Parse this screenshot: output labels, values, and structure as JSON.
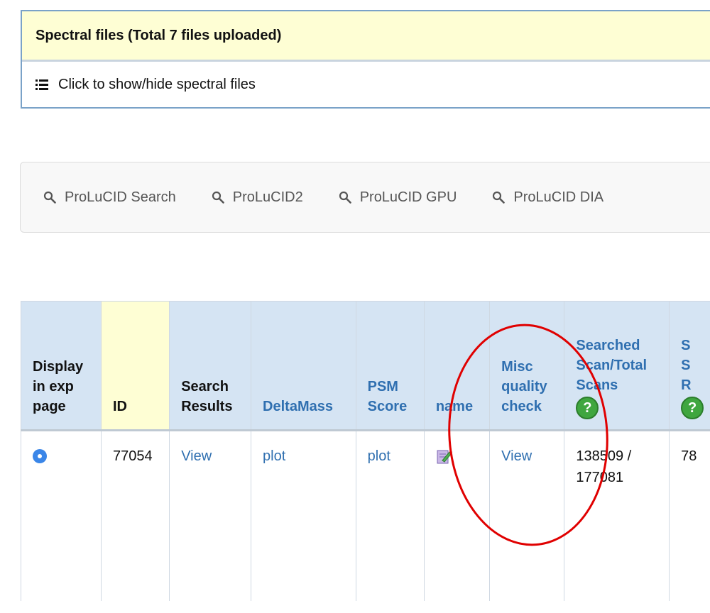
{
  "spectral_panel": {
    "title": "Spectral files (Total 7 files uploaded)",
    "toggle_label": "Click to show/hide spectral files"
  },
  "search_nav": {
    "items": [
      {
        "label": "ProLuCID Search",
        "icon": "search-icon"
      },
      {
        "label": "ProLuCID2",
        "icon": "search-icon"
      },
      {
        "label": "ProLuCID GPU",
        "icon": "search-icon"
      },
      {
        "label": "ProLuCID DIA",
        "icon": "search-icon"
      }
    ]
  },
  "table": {
    "headers": {
      "display": "Display in exp page",
      "id": "ID",
      "search_results": "Search Results",
      "deltamass": "DeltaMass",
      "psm_score": "PSM Score",
      "name": "name",
      "misc": "Misc quality check",
      "searched": "Searched Scan/Total Scans",
      "next": "S S R"
    },
    "row": {
      "id": "77054",
      "search_results": "View",
      "deltamass": "plot",
      "psm_score": "plot",
      "name_icon": "edit-icon",
      "misc": "View",
      "searched": "138509 / 177081",
      "next": "78"
    }
  },
  "help_icon": "?",
  "colors": {
    "link": "#2f6fb0",
    "header_bg": "#d5e4f3",
    "id_header_bg": "#fefed4",
    "panel_head_bg": "#fefed4",
    "annotation": "#e00000"
  }
}
